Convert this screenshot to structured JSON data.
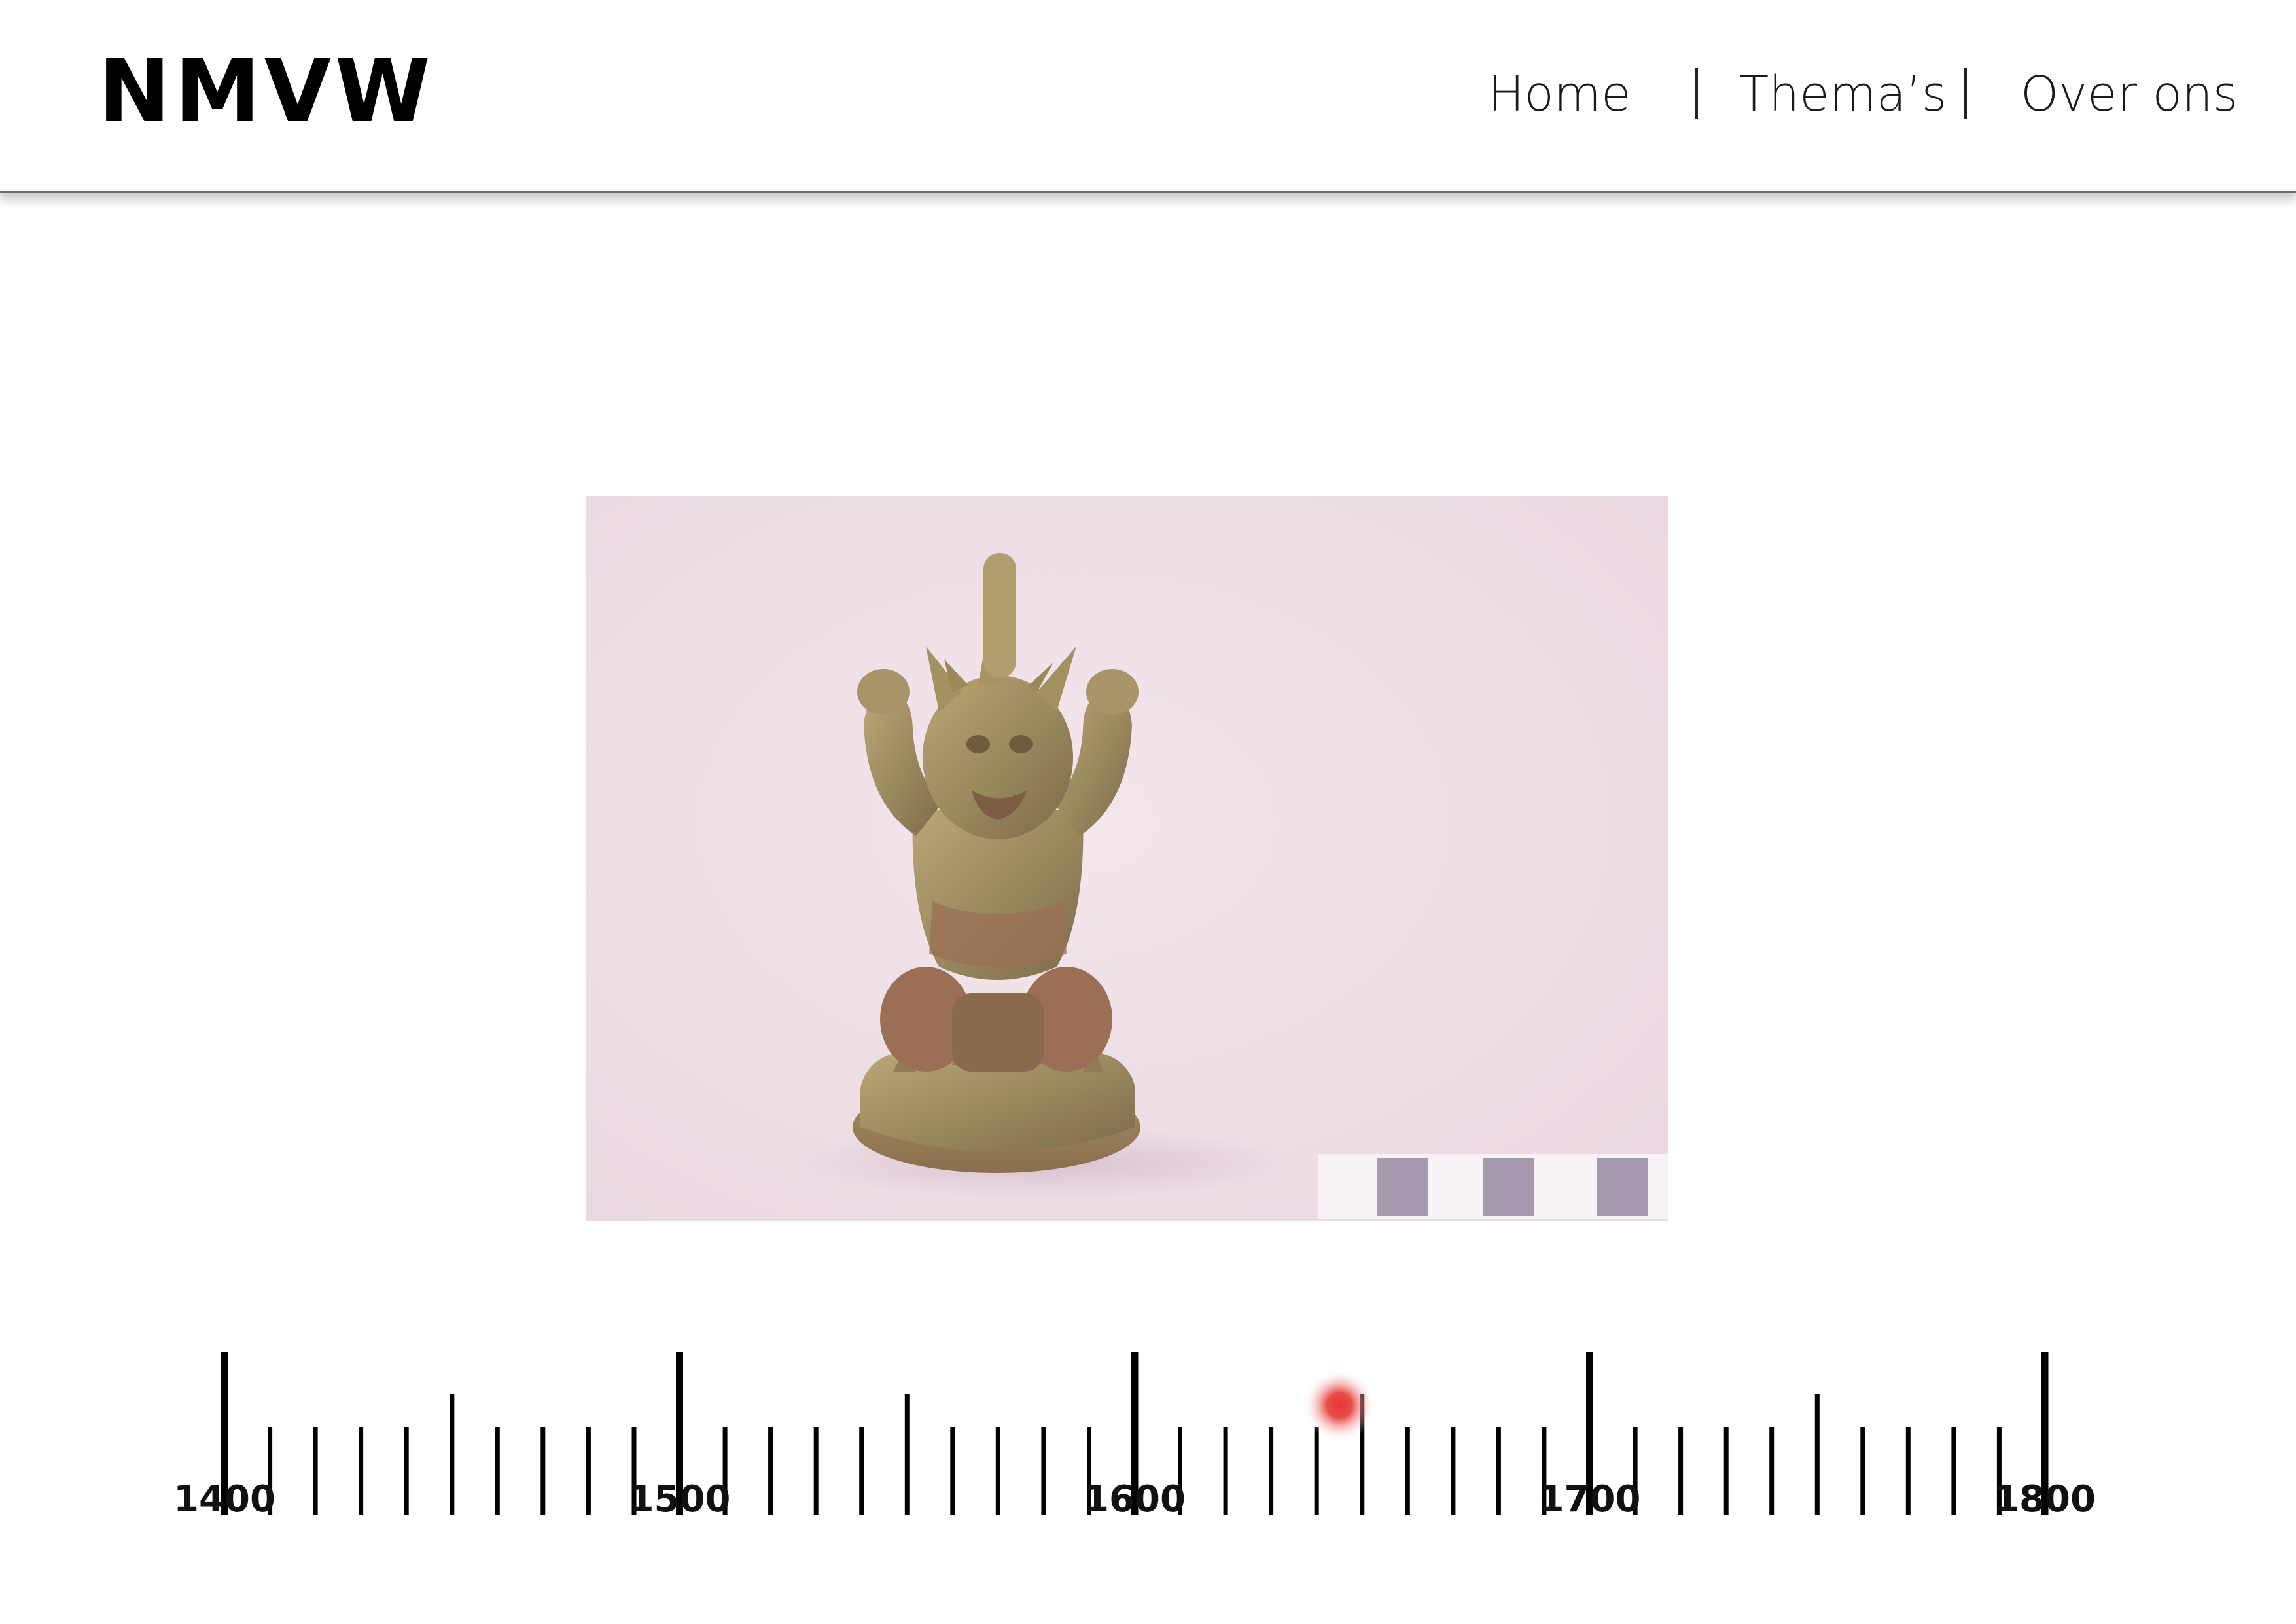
{
  "header": {
    "logo": "NMVW",
    "nav": [
      {
        "label": "Home"
      },
      {
        "label": "Thema’s"
      },
      {
        "label": "Over ons"
      }
    ]
  },
  "artifact": {
    "image_description": "bronze figurine",
    "scale_bar": true
  },
  "timeline": {
    "start_year": 1400,
    "end_year": 1800,
    "major_step": 100,
    "minor_step": 10,
    "labels": [
      "1400",
      "1500",
      "1600",
      "1700",
      "1800"
    ],
    "marker_year": 1645,
    "marker_color": "#e53935"
  },
  "colors": {
    "text": "#111111",
    "header_bg": "#ffffff",
    "tick": "#000000"
  }
}
